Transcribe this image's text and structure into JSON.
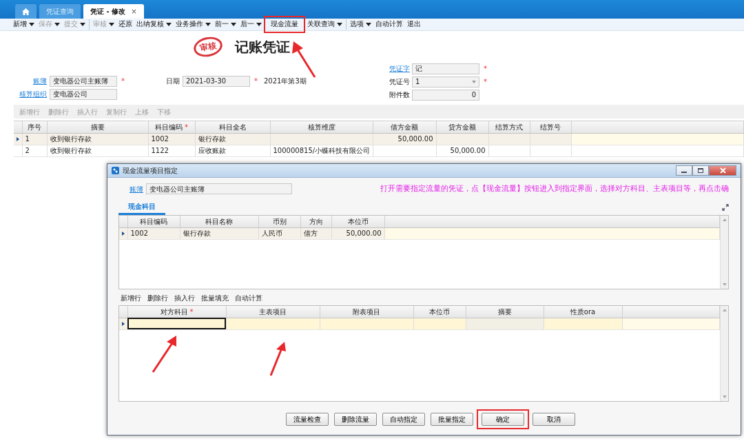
{
  "tabs": [
    {
      "kind": "home",
      "selected": false
    },
    {
      "kind": "page",
      "label": "凭证查询",
      "selected": false
    },
    {
      "kind": "page",
      "label": "凭证 - 修改",
      "selected": true,
      "close": "×"
    }
  ],
  "toolbar": [
    {
      "label": "新增",
      "dropdown": true,
      "disabled": false,
      "separator_before": false,
      "highlighted": false
    },
    {
      "label": "保存",
      "dropdown": true,
      "disabled": true,
      "separator_before": false,
      "highlighted": false
    },
    {
      "label": "提交",
      "dropdown": true,
      "disabled": true,
      "separator_before": false,
      "highlighted": false
    },
    {
      "label": "审核",
      "dropdown": true,
      "disabled": true,
      "separator_before": true,
      "highlighted": false
    },
    {
      "label": "还原",
      "dropdown": false,
      "disabled": false,
      "separator_before": false,
      "highlighted": false
    },
    {
      "label": "出纳复核",
      "dropdown": true,
      "disabled": false,
      "separator_before": false,
      "highlighted": false
    },
    {
      "label": "业务操作",
      "dropdown": true,
      "disabled": false,
      "separator_before": false,
      "highlighted": false
    },
    {
      "label": "前一",
      "dropdown": true,
      "disabled": false,
      "separator_before": false,
      "highlighted": false
    },
    {
      "label": "后一",
      "dropdown": true,
      "disabled": false,
      "separator_before": false,
      "highlighted": false
    },
    {
      "label": "现金流量",
      "dropdown": false,
      "disabled": false,
      "separator_before": false,
      "highlighted": true
    },
    {
      "label": "关联查询",
      "dropdown": true,
      "disabled": false,
      "separator_before": false,
      "highlighted": false
    },
    {
      "label": "选项",
      "dropdown": true,
      "disabled": false,
      "separator_before": true,
      "highlighted": false
    },
    {
      "label": "自动计算",
      "dropdown": false,
      "disabled": false,
      "separator_before": false,
      "highlighted": false
    },
    {
      "label": "退出",
      "dropdown": false,
      "disabled": false,
      "separator_before": false,
      "highlighted": false
    }
  ],
  "voucher": {
    "stamp": "审核",
    "title": "记账凭证",
    "left_fields": [
      {
        "label": "账簿",
        "link": true,
        "value": "变电器公司主账簿",
        "required": "*"
      },
      {
        "label": "核算组织",
        "link": true,
        "value": "变电器公司"
      }
    ],
    "date": {
      "label": "日期",
      "link": false,
      "value": "2021-03-30",
      "required": "*"
    },
    "period": "2021年第3期",
    "right_fields": [
      {
        "label": "凭证字",
        "link": true,
        "value": "记",
        "required": "*",
        "dropdown": false,
        "numeric": false
      },
      {
        "label": "凭证号",
        "link": false,
        "value": "1",
        "required": "*",
        "dropdown": true,
        "numeric": false
      },
      {
        "label": "附件数",
        "link": false,
        "value": "0",
        "dropdown": false,
        "numeric": true
      }
    ]
  },
  "entry_toolbar": [
    {
      "label": "新增行",
      "disabled": true
    },
    {
      "label": "删除行",
      "disabled": true
    },
    {
      "label": "插入行",
      "disabled": true
    },
    {
      "label": "复制行",
      "disabled": true
    },
    {
      "label": "上移",
      "disabled": true
    },
    {
      "label": "下移",
      "disabled": true
    }
  ],
  "entries": {
    "columns": [
      {
        "label": "序号",
        "numeric": false
      },
      {
        "label": "摘要",
        "numeric": false
      },
      {
        "label": "科目编码",
        "required": "*",
        "numeric": false
      },
      {
        "label": "科目全名",
        "numeric": false
      },
      {
        "label": "核算维度"
      },
      {
        "label": "借方金额",
        "numeric": true
      },
      {
        "label": "贷方金额",
        "numeric": true
      },
      {
        "label": "结算方式"
      },
      {
        "label": "结算号"
      }
    ],
    "rows": [
      {
        "selected": true,
        "cells": [
          "1",
          "收到银行存款",
          "1002",
          "银行存款",
          null,
          "50,000.00",
          null,
          null,
          null
        ]
      },
      {
        "selected": false,
        "cells": [
          "2",
          "收到银行存款",
          "1122",
          "应收账款",
          "100000815/小蝶科技有限公司",
          null,
          "50,000.00",
          null,
          null
        ]
      }
    ]
  },
  "dialog": {
    "title": "现金流量项目指定",
    "book": {
      "label": "账簿",
      "value": "变电器公司主账簿"
    },
    "note": "打开需要指定流量的凭证，点【现金流量】按钮进入到指定界面，选择对方科目、主表项目等，再点击确",
    "tabs": [
      {
        "label": "现金科目",
        "selected": true
      }
    ],
    "accounts": {
      "columns": [
        {
          "label": "科目编码",
          "numeric": false
        },
        {
          "label": "科目名称",
          "numeric": false
        },
        {
          "label": "币别",
          "numeric": false
        },
        {
          "label": "方向",
          "numeric": false
        },
        {
          "label": "本位币",
          "numeric": true
        }
      ],
      "rows": [
        {
          "selected": true,
          "cells": [
            "1002",
            "银行存款",
            "人民币",
            "借方",
            "50,000.00"
          ]
        }
      ]
    },
    "toolbar": [
      "新增行",
      "删除行",
      "插入行",
      "批量填充",
      "自动计算"
    ],
    "items": {
      "columns": [
        {
          "label": "对方科目",
          "required": "*",
          "editable": true
        },
        {
          "label": "主表项目",
          "editable": true
        },
        {
          "label": "附表项目",
          "editable": true
        },
        {
          "label": "本位币",
          "editable": true
        },
        {
          "label": "摘要",
          "editable": false
        },
        {
          "label": "性质ora",
          "editable": true
        }
      ],
      "rows": [
        {
          "selected": true,
          "cells": [
            {
              "focused": true
            },
            {
              "focused": false
            },
            {
              "focused": false
            },
            {
              "focused": false
            },
            {
              "focused": false
            },
            {
              "focused": false
            }
          ]
        }
      ]
    },
    "buttons": [
      {
        "label": "流量检查",
        "highlighted": false
      },
      {
        "label": "删除流量",
        "highlighted": false
      },
      {
        "label": "自动指定",
        "highlighted": false
      },
      {
        "label": "批量指定",
        "highlighted": false
      },
      {
        "label": "确定",
        "highlighted": true
      },
      {
        "label": "取消",
        "highlighted": false
      }
    ]
  }
}
